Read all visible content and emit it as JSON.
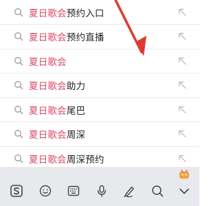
{
  "suggestions": [
    {
      "highlight": "夏日歌会",
      "rest": "预约入口"
    },
    {
      "highlight": "夏日歌会",
      "rest": "预约直播"
    },
    {
      "highlight": "夏日歌会",
      "rest": ""
    },
    {
      "highlight": "夏日歌会",
      "rest": "助力"
    },
    {
      "highlight": "夏日歌会",
      "rest": "尾巴"
    },
    {
      "highlight": "夏日歌会",
      "rest": "周深"
    },
    {
      "highlight": "夏日歌会",
      "rest": "周深预约"
    }
  ],
  "colors": {
    "highlight": "#d94a67",
    "text": "#222222",
    "arrow": "#e03a2f",
    "keyboard_bg": "#e8e9ed"
  },
  "keyboard_toolbar": [
    {
      "icon": "sogou-logo-icon"
    },
    {
      "icon": "emoji-icon"
    },
    {
      "icon": "keyboard-layout-icon"
    },
    {
      "icon": "microphone-icon"
    },
    {
      "icon": "handwriting-icon"
    },
    {
      "icon": "search-icon"
    },
    {
      "icon": "collapse-keyboard-icon"
    }
  ]
}
